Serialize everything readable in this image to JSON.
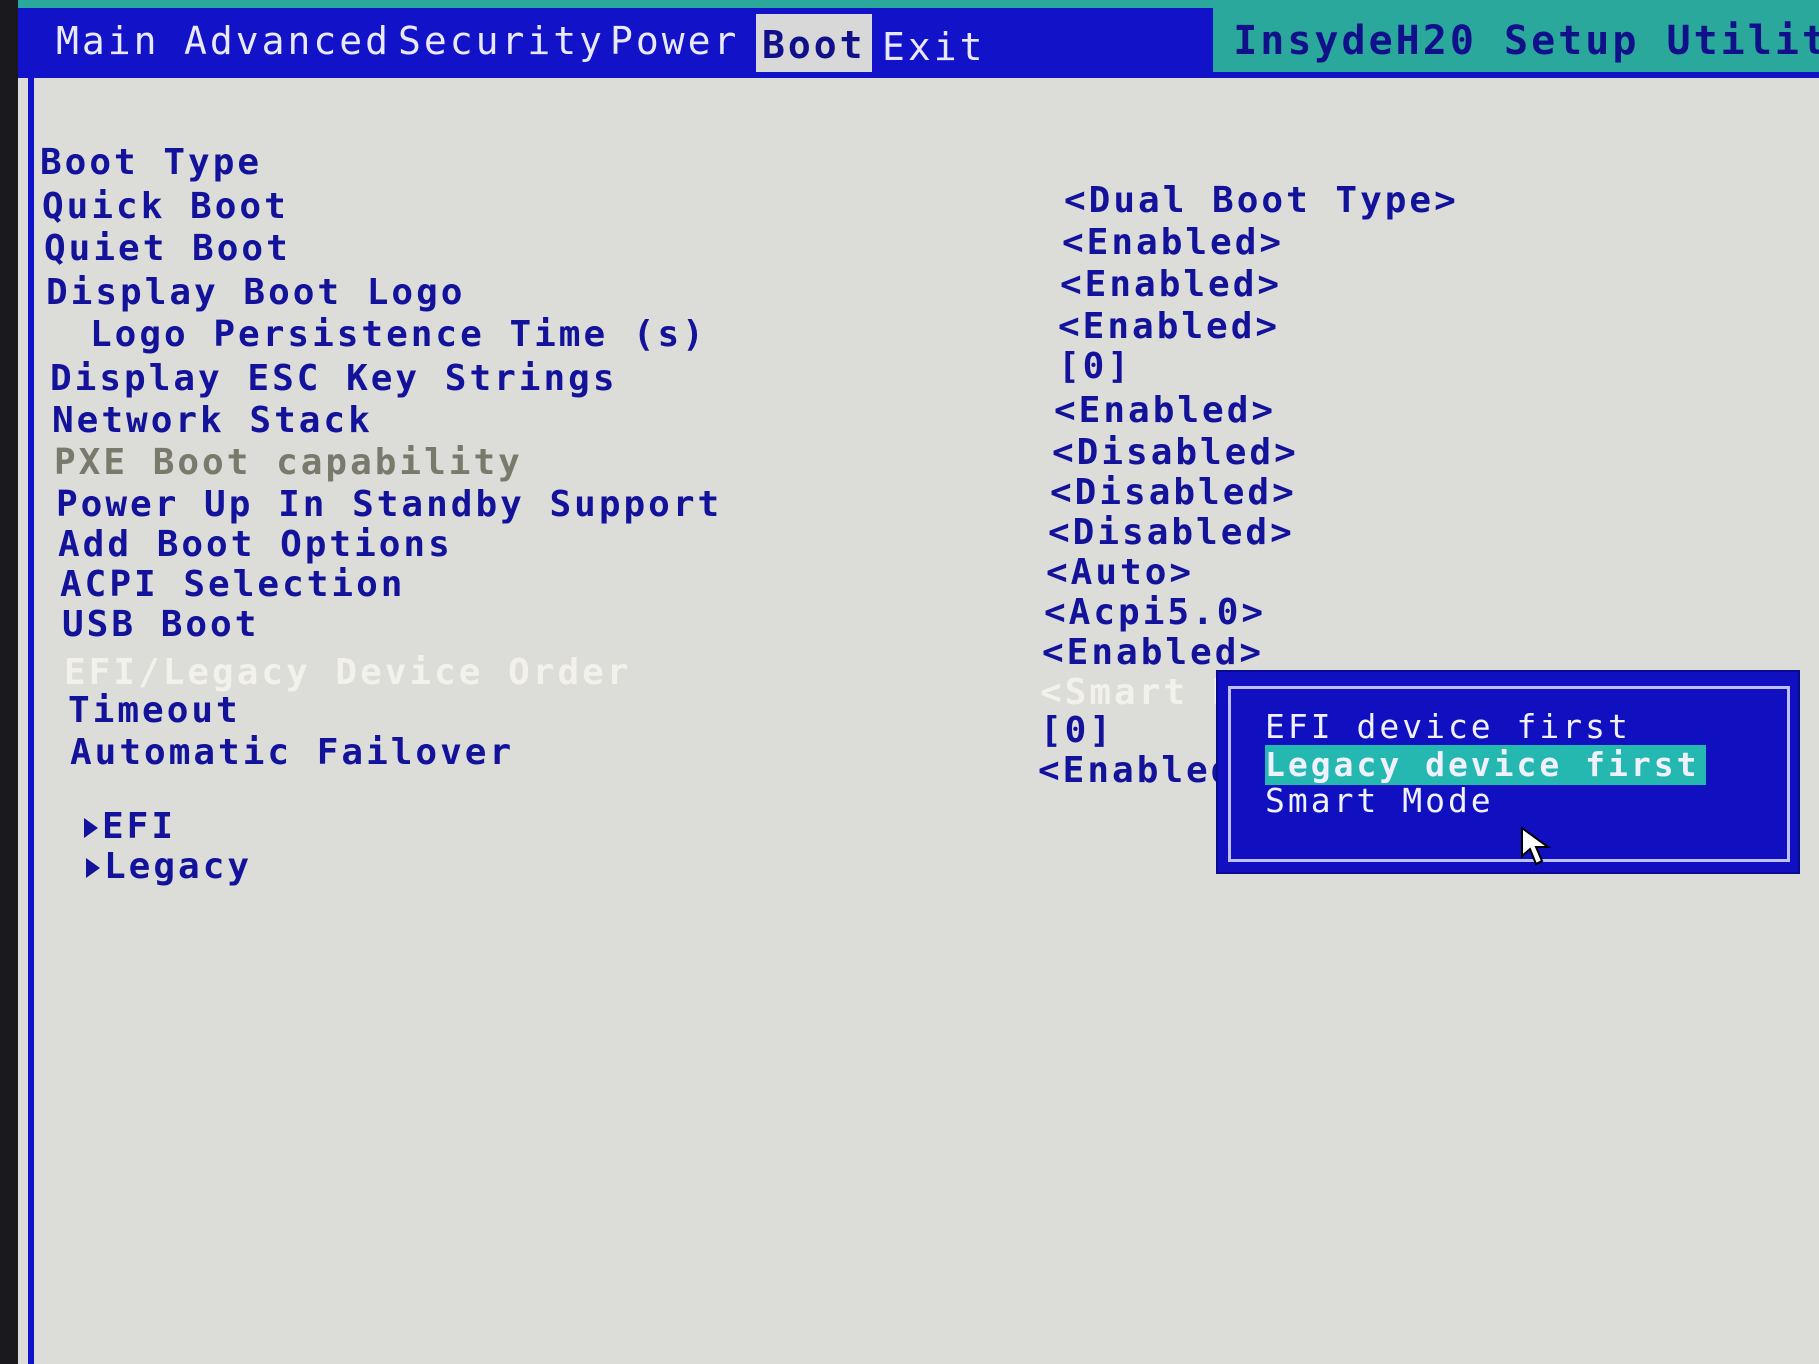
{
  "menu": {
    "tabs": [
      {
        "label": "Main"
      },
      {
        "label": "Advanced"
      },
      {
        "label": "Security"
      },
      {
        "label": "Power"
      },
      {
        "label": "Boot"
      },
      {
        "label": "Exit"
      }
    ],
    "active_tab": "Boot",
    "utility_title": "InsydeH20 Setup Utilit"
  },
  "settings": [
    {
      "label": "Boot Type",
      "value": "<Dual Boot Type>"
    },
    {
      "label": "Quick Boot",
      "value": "<Enabled>"
    },
    {
      "label": "Quiet Boot",
      "value": "<Enabled>"
    },
    {
      "label": "Display Boot Logo",
      "value": "<Enabled>"
    },
    {
      "label": "Logo Persistence Time (s)",
      "value": "[0]"
    },
    {
      "label": "Display ESC Key Strings",
      "value": "<Enabled>"
    },
    {
      "label": "Network Stack",
      "value": "<Disabled>"
    },
    {
      "label": "PXE Boot capability",
      "value": "<Disabled>"
    },
    {
      "label": "Power Up In Standby Support",
      "value": "<Disabled>"
    },
    {
      "label": "Add Boot Options",
      "value": "<Auto>"
    },
    {
      "label": "ACPI Selection",
      "value": "<Acpi5.0>"
    },
    {
      "label": "USB Boot",
      "value": "<Enabled>"
    },
    {
      "label": "EFI/Legacy Device Order",
      "value": "<Smart M"
    },
    {
      "label": "Timeout",
      "value": "[0]"
    },
    {
      "label": "Automatic Failover",
      "value": "<Enabled"
    }
  ],
  "submenus": [
    {
      "label": "EFI"
    },
    {
      "label": "Legacy"
    }
  ],
  "popup": {
    "options": [
      {
        "label": "EFI device first"
      },
      {
        "label": "Legacy device first"
      },
      {
        "label": "Smart Mode"
      }
    ],
    "highlighted": "Legacy device first"
  },
  "colors": {
    "menubar": "#1212c8",
    "text": "#12129a",
    "background": "#dcdcd8",
    "highlight": "#24b8b0"
  }
}
